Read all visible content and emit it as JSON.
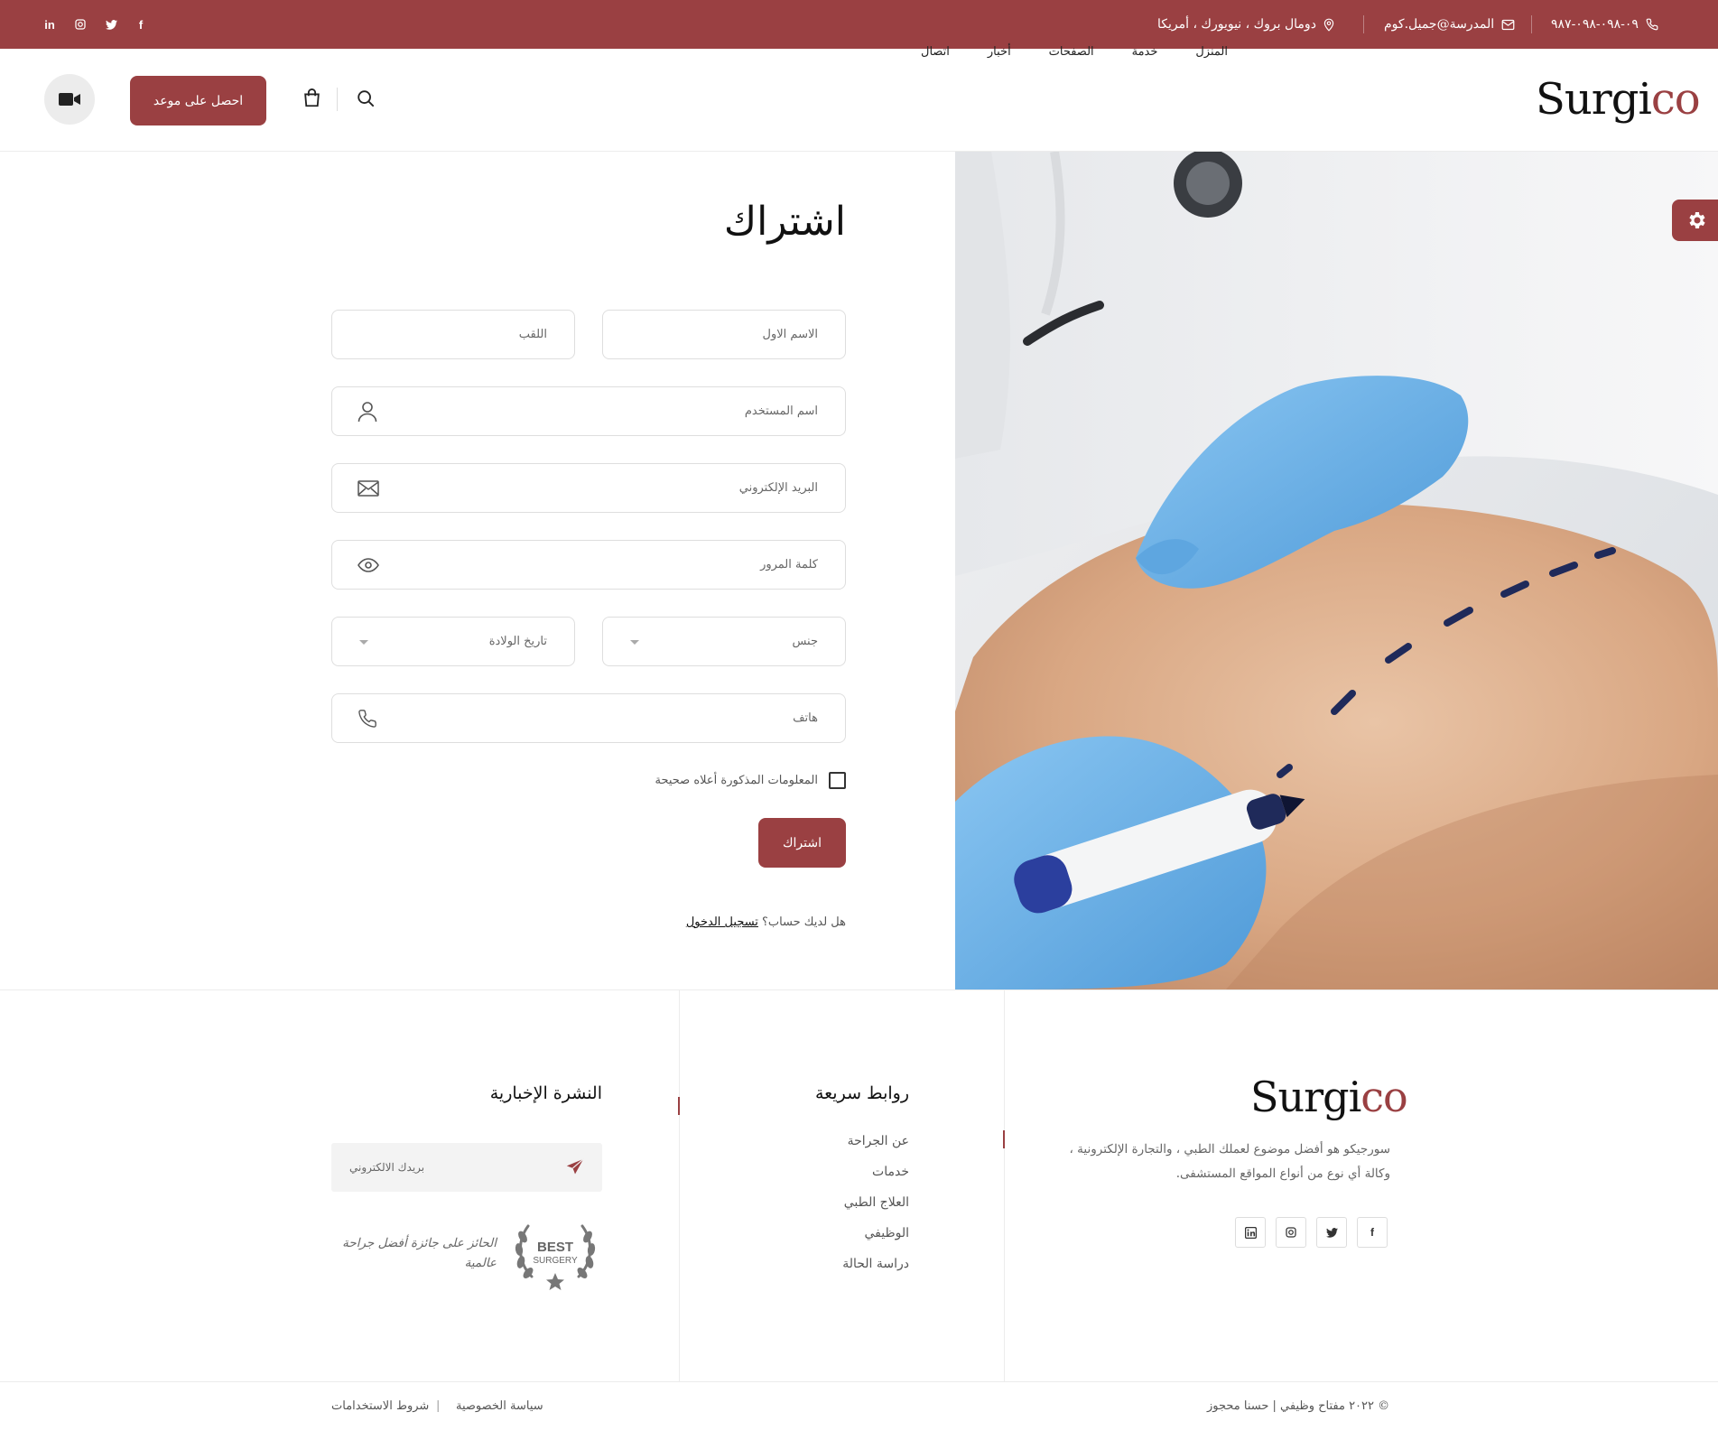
{
  "topbar": {
    "phone": "٠٩-٠٩٨-٠٩٨-٩٨٧",
    "email": "المدرسة@جميل.كوم",
    "address": "دومال بروك ، نيويورك ، أمريكا",
    "social": [
      "facebook-icon",
      "twitter-icon",
      "instagram-icon",
      "linkedin-icon"
    ]
  },
  "header": {
    "logo_main": "Surgi",
    "logo_accent": "co",
    "nav": [
      "المنزل",
      "خدمة",
      "الصفحات",
      "أخبار",
      "اتصال"
    ],
    "appointment_label": "احصل على موعد"
  },
  "form": {
    "title": "اشتراك",
    "first_name_placeholder": "الاسم الاول",
    "last_name_placeholder": "اللقب",
    "username_placeholder": "اسم المستخدم",
    "email_placeholder": "البريد الإلكتروني",
    "password_placeholder": "كلمة المرور",
    "gender_placeholder": "جنس",
    "birthdate_placeholder": "تاريخ الولادة",
    "phone_placeholder": "هاتف",
    "confirm_label": "المعلومات المذكورة أعلاه صحيحة",
    "submit_label": "اشتراك",
    "has_account_text": "هل لديك حساب؟",
    "login_link": "تسجيل الدخول"
  },
  "footer": {
    "about_logo_main": "Surgi",
    "about_logo_accent": "co",
    "about_text": "سورجيكو هو أفضل موضوع لعملك الطبي ، والتجارة الإلكترونية ، وكالة أي نوع من أنواع المواقع المستشفى.",
    "quick_links_heading": "روابط سريعة",
    "quick_links": [
      "عن الجراحة",
      "خدمات",
      "العلاج الطبي",
      "الوظيفي",
      "دراسة الحالة"
    ],
    "newsletter_heading": "النشرة الإخبارية",
    "newsletter_placeholder": "بريدك الالكتروني",
    "award_text": "الحائز على جائزة أفضل جراحة عالمية",
    "badge_line1": "BEST",
    "badge_line2": "SURGERY",
    "copyright": "© ٢٠٢٢ مفتاح وظيفي | حسنا محجوز",
    "privacy": "سياسة الخصوصية",
    "separator": "|",
    "terms": "شروط الاستخدامات"
  },
  "colors": {
    "brand": "#9a4042",
    "glove": "#6fb3ea"
  }
}
